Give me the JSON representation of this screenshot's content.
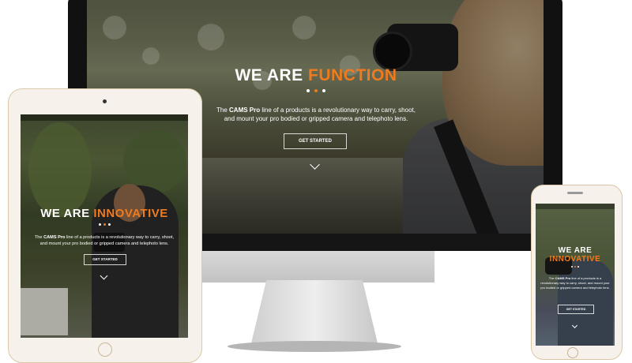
{
  "desktop": {
    "headline_white": "WE ARE ",
    "headline_accent": "FUNCTION",
    "body_prefix": "The ",
    "body_brand": "CAMS Pro",
    "body_line1_rest": " line of a products is a revolutionary way to carry, shoot,",
    "body_line2": "and mount your pro bodied or gripped camera and telephoto lens.",
    "cta_label": "GET STARTED"
  },
  "tablet": {
    "headline_white": "WE ARE ",
    "headline_accent": "INNOVATIVE",
    "body_prefix": "The ",
    "body_brand": "CAMS Pro",
    "body_line1_rest": " line of a products is a revolutionary way to carry, shoot,",
    "body_line2": "and mount your pro bodied or gripped camera and telephoto lens.",
    "cta_label": "GET STARTED"
  },
  "phone": {
    "headline_line1": "WE ARE",
    "headline_accent": "INNOVATIVE",
    "body_prefix": "The ",
    "body_brand": "CAMS Pro",
    "body_rest": " line of a products is a revolutionary way to carry, shoot, and mount your pro bodied or gripped camera and telephoto lens.",
    "cta_label": "GET STARTED"
  },
  "colors": {
    "accent": "#f07b1e",
    "text": "#ffffff"
  }
}
